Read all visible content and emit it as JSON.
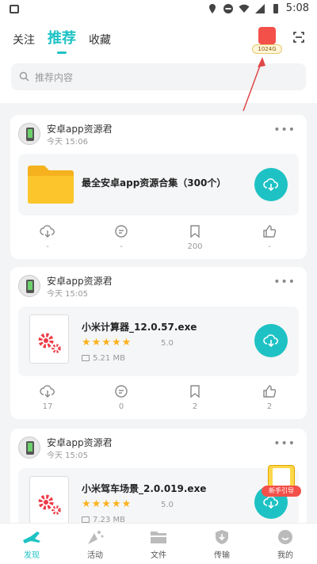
{
  "status_bar": {
    "time": "5:08"
  },
  "header": {
    "tabs": [
      {
        "label": "关注",
        "active": false
      },
      {
        "label": "推荐",
        "active": true
      },
      {
        "label": "收藏",
        "active": false
      }
    ],
    "gift_badge": "1024G",
    "search_placeholder": "推荐内容"
  },
  "posts": [
    {
      "author": "安卓app资源君",
      "time": "今天 15:06",
      "file": {
        "type": "folder",
        "name": "最全安卓app资源合集（300个）"
      },
      "actions": {
        "download": "-",
        "comment": "-",
        "bookmark": "200",
        "like": "-"
      }
    },
    {
      "author": "安卓app资源君",
      "time": "今天 15:05",
      "file": {
        "type": "exe",
        "name": "小米计算器_12.0.57.exe",
        "stars": "★★★★★",
        "rating": "5.0",
        "size": "5.21 MB"
      },
      "actions": {
        "download": "17",
        "comment": "0",
        "bookmark": "2",
        "like": "2"
      }
    },
    {
      "author": "安卓app资源君",
      "time": "今天 15:05",
      "file": {
        "type": "exe",
        "name": "小米驾车场景_2.0.019.exe",
        "stars": "★★★★★",
        "rating": "5.0",
        "size": "7.23 MB"
      }
    }
  ],
  "floating_guide": "新手引导",
  "bottom_nav": [
    {
      "label": "发现",
      "icon": "discover-icon",
      "active": true
    },
    {
      "label": "活动",
      "icon": "activity-icon",
      "active": false
    },
    {
      "label": "文件",
      "icon": "folder-icon",
      "active": false
    },
    {
      "label": "传输",
      "icon": "transfer-icon",
      "active": false
    },
    {
      "label": "我的",
      "icon": "profile-icon",
      "active": false
    }
  ],
  "colors": {
    "accent": "#1ec2c4",
    "star": "#fbb21c",
    "folder": "#fcc52c",
    "gear": "#ef3b47",
    "arrow": "#e04848"
  }
}
